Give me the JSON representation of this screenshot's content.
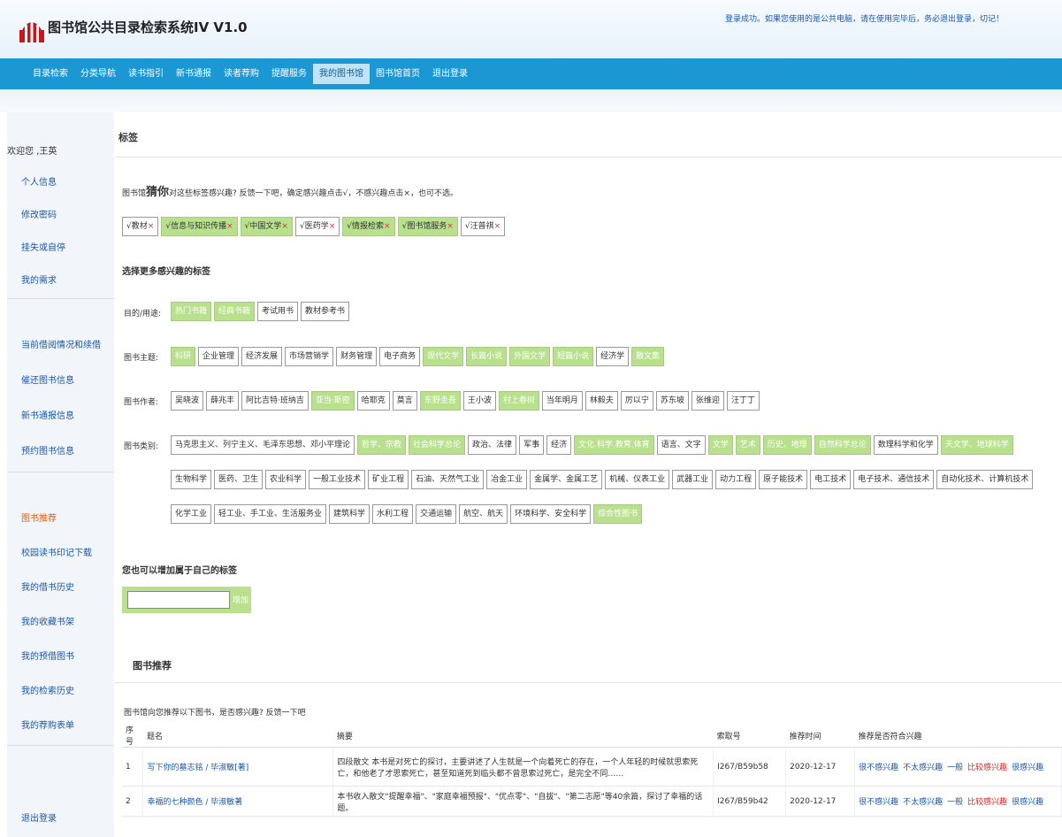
{
  "header": {
    "title": "图书馆公共目录检索系统IV V1.0",
    "notice": "登录成功。如果您使用的是公共电脑，请在使用完毕后，务必退出登录，切记！"
  },
  "nav": {
    "items": [
      "目录检索",
      "分类导航",
      "读书指引",
      "新书通报",
      "读者荐购",
      "提醒服务",
      "我的图书馆",
      "图书馆首页",
      "退出登录"
    ],
    "active_index": 6
  },
  "sidebar": {
    "welcome": "欢迎您 ,王英",
    "group1": [
      "个人信息",
      "修改密码",
      "挂失或自停",
      "我的需求"
    ],
    "group2": [
      "当前借阅情况和续借",
      "催还图书信息",
      "新书通报信息",
      "预约图书信息"
    ],
    "group3": [
      "图书推荐",
      "校园读书印记下载",
      "我的借书历史",
      "我的收藏书架",
      "我的预借图书",
      "我的检索历史",
      "我的荐购表单"
    ],
    "logout": "退出登录"
  },
  "tags": {
    "section_title": "标签",
    "prompt_prefix": "图书馆",
    "prompt_emph": "猜你",
    "prompt_suffix": "对这些标签感兴趣? 反馈一下吧，确定感兴趣点击√，不感兴趣点击×，也可不选。",
    "guessed": [
      {
        "label": "教材",
        "selected": false
      },
      {
        "label": "信息与知识传播",
        "selected": true
      },
      {
        "label": "中国文学",
        "selected": true
      },
      {
        "label": "医药学",
        "selected": false
      },
      {
        "label": "情报检索",
        "selected": true
      },
      {
        "label": "图书馆服务",
        "selected": true
      },
      {
        "label": "汪普祺",
        "selected": false
      }
    ],
    "check_mark": "√",
    "cross_mark": "×",
    "more_title": "选择更多感兴趣的标签",
    "purpose": {
      "label": "目的/用途:",
      "items": [
        {
          "label": "热门书籍",
          "selected": true
        },
        {
          "label": "经典书籍",
          "selected": true
        },
        {
          "label": "考试用书",
          "selected": false
        },
        {
          "label": "教材参考书",
          "selected": false
        }
      ]
    },
    "topic": {
      "label": "图书主题:",
      "items": [
        {
          "label": "科研",
          "selected": true
        },
        {
          "label": "企业管理",
          "selected": false
        },
        {
          "label": "经济发展",
          "selected": false
        },
        {
          "label": "市场营销学",
          "selected": false
        },
        {
          "label": "财务管理",
          "selected": false
        },
        {
          "label": "电子商务",
          "selected": false
        },
        {
          "label": "现代文学",
          "selected": true
        },
        {
          "label": "长篇小说",
          "selected": true
        },
        {
          "label": "外国文学",
          "selected": true
        },
        {
          "label": "短篇小说",
          "selected": true
        },
        {
          "label": "经济学",
          "selected": false
        },
        {
          "label": "散文集",
          "selected": true
        }
      ]
    },
    "author": {
      "label": "图书作者:",
      "items": [
        {
          "label": "吴晓波",
          "selected": false
        },
        {
          "label": "薛兆丰",
          "selected": false
        },
        {
          "label": "阿比吉特·班纳吉",
          "selected": false
        },
        {
          "label": "亚当·斯密",
          "selected": true
        },
        {
          "label": "哈耶克",
          "selected": false
        },
        {
          "label": "莫言",
          "selected": false
        },
        {
          "label": "东野圭吾",
          "selected": true
        },
        {
          "label": "王小波",
          "selected": false
        },
        {
          "label": "村上春树",
          "selected": true
        },
        {
          "label": "当年明月",
          "selected": false
        },
        {
          "label": "林毅夫",
          "selected": false
        },
        {
          "label": "厉以宁",
          "selected": false
        },
        {
          "label": "苏东坡",
          "selected": false
        },
        {
          "label": "张维迎",
          "selected": false
        },
        {
          "label": "汪丁丁",
          "selected": false
        }
      ]
    },
    "category": {
      "label": "图书类别:",
      "items": [
        {
          "label": "马克思主义、列宁主义、毛泽东思想、邓小平理论",
          "selected": false
        },
        {
          "label": "哲学、宗教",
          "selected": true
        },
        {
          "label": "社会科学总论",
          "selected": true
        },
        {
          "label": "政治、法律",
          "selected": false
        },
        {
          "label": "军事",
          "selected": false
        },
        {
          "label": "经济",
          "selected": false
        },
        {
          "label": "文化.科学.教育.体育",
          "selected": true
        },
        {
          "label": "语言、文字",
          "selected": false
        },
        {
          "label": "文学",
          "selected": true
        },
        {
          "label": "艺术",
          "selected": true
        },
        {
          "label": "历史、地理",
          "selected": true
        },
        {
          "label": "自然科学总论",
          "selected": true
        },
        {
          "label": "数理科学和化学",
          "selected": false
        },
        {
          "label": "天文学、地球科学",
          "selected": true
        },
        {
          "label": "生物科学",
          "selected": false
        },
        {
          "label": "医药、卫生",
          "selected": false
        },
        {
          "label": "农业科学",
          "selected": false
        },
        {
          "label": "一般工业技术",
          "selected": false
        },
        {
          "label": "矿业工程",
          "selected": false
        },
        {
          "label": "石油、天然气工业",
          "selected": false
        },
        {
          "label": "冶金工业",
          "selected": false
        },
        {
          "label": "金属学、金属工艺",
          "selected": false
        },
        {
          "label": "机械、仪表工业",
          "selected": false
        },
        {
          "label": "武器工业",
          "selected": false
        },
        {
          "label": "动力工程",
          "selected": false
        },
        {
          "label": "原子能技术",
          "selected": false
        },
        {
          "label": "电工技术",
          "selected": false
        },
        {
          "label": "电子技术、通信技术",
          "selected": false
        },
        {
          "label": "自动化技术、计算机技术",
          "selected": false
        },
        {
          "label": "化学工业",
          "selected": false
        },
        {
          "label": "轻工业、手工业、生活服务业",
          "selected": false
        },
        {
          "label": "建筑科学",
          "selected": false
        },
        {
          "label": "水利工程",
          "selected": false
        },
        {
          "label": "交通运输",
          "selected": false
        },
        {
          "label": "航空、航天",
          "selected": false
        },
        {
          "label": "环境科学、安全科学",
          "selected": false
        },
        {
          "label": "综合性图书",
          "selected": true
        }
      ]
    },
    "custom_title": "您也可以增加属于自己的标签",
    "add_label": "增加",
    "custom_value": ""
  },
  "recommend": {
    "title": "图书推荐",
    "note": "图书馆向您推荐以下图书，是否感兴趣? 反馈一下吧",
    "columns": [
      "序号",
      "题名",
      "摘要",
      "索取号",
      "推荐时间",
      "推荐是否符合兴趣"
    ],
    "rows": [
      {
        "no": "1",
        "title": "写下你的墓志铭 / 毕淑敏[著]",
        "abstract": "四段散文 本书是对死亡的探讨，主要讲述了人生就是一个向着死亡的存在，一个人年轻的时候就思索死亡，和他老了才思索死亡，甚至知道死到临头都不曾思索过死亡，是完全不同……",
        "call_no": "I267/B59b58",
        "date": "2020-12-17"
      },
      {
        "no": "2",
        "title": "幸福的七种颜色 / 毕淑敏著",
        "abstract": "本书收入散文\"提醒幸福\"、\"家庭幸福预报\"、\"优点零\"、\"自拔\"、\"第二志愿\"等40余篇，探讨了幸福的话题。",
        "call_no": "I267/B59b42",
        "date": "2020-12-17"
      }
    ],
    "feedback": [
      "很不感兴趣",
      "不太感兴趣",
      "一般",
      "比较感兴趣",
      "很感兴趣"
    ],
    "feedback_highlight_index": 3
  }
}
